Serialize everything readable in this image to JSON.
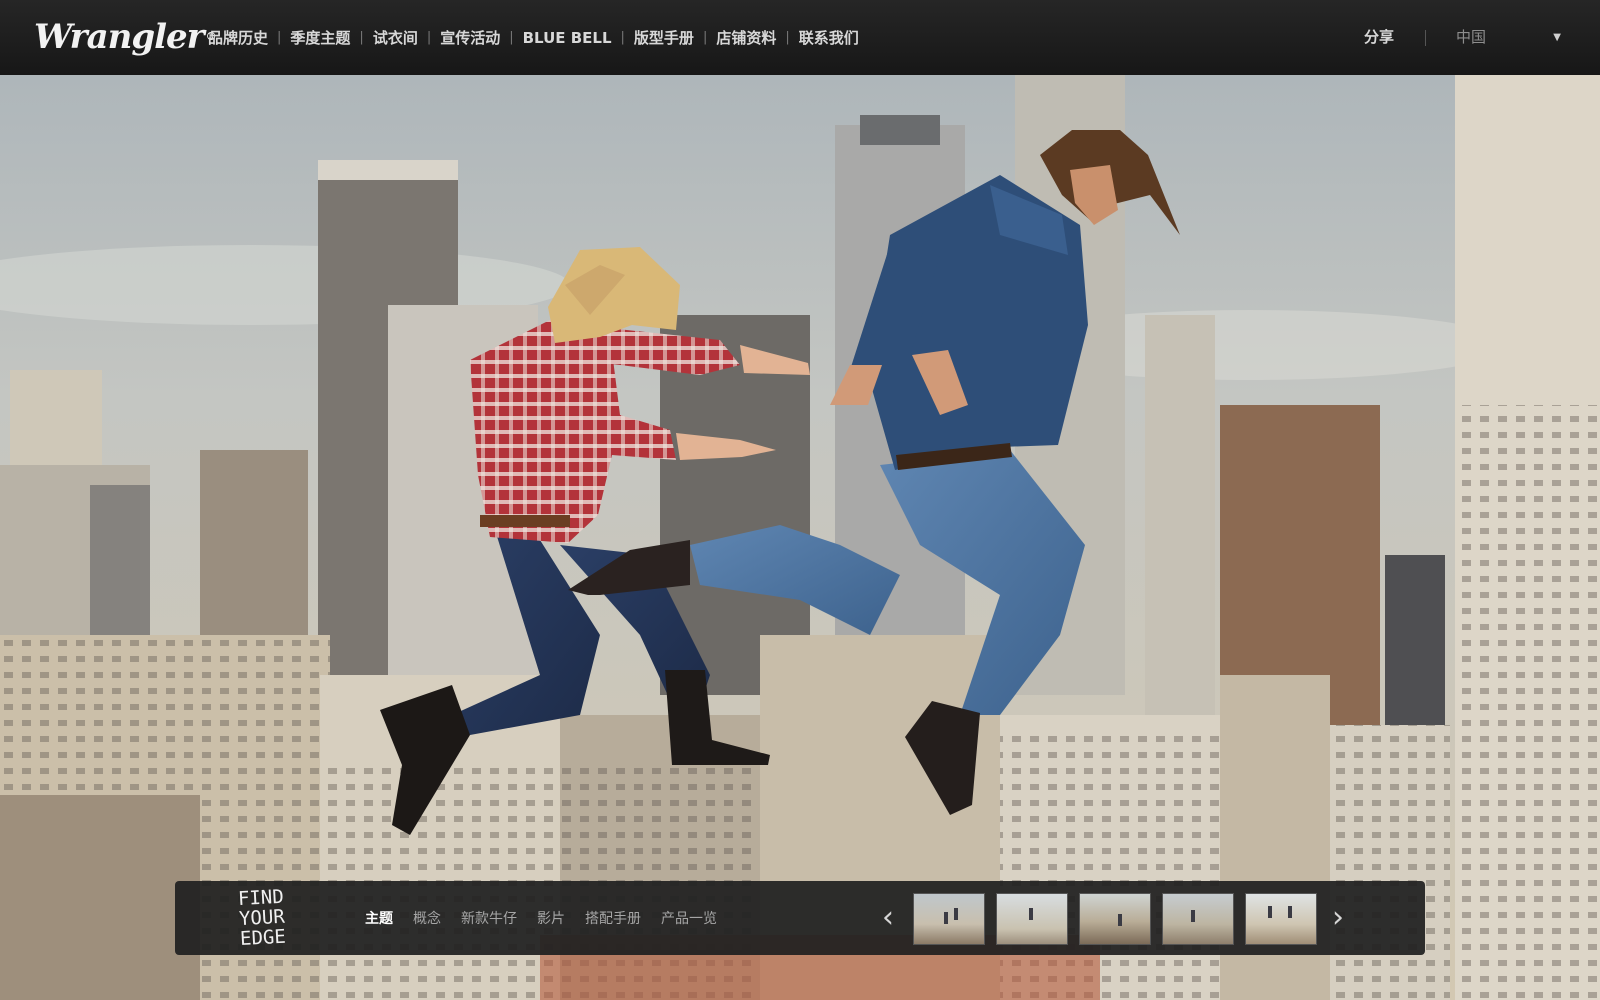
{
  "brand": {
    "logo_text": "Wrangler",
    "logo_mark": "®"
  },
  "main_nav": [
    {
      "label": "品牌历史"
    },
    {
      "label": "季度主题"
    },
    {
      "label": "试衣间"
    },
    {
      "label": "宣传活动"
    },
    {
      "label": "BLUE BELL"
    },
    {
      "label": "版型手册"
    },
    {
      "label": "店铺资料"
    },
    {
      "label": "联系我们"
    }
  ],
  "nav_separator": "|",
  "header_right": {
    "share_label": "分享",
    "region_label": "中国",
    "region_caret": "▼"
  },
  "bottom_bar": {
    "slogan": [
      "FIND",
      "YOUR",
      "EDGE"
    ],
    "subnav": [
      {
        "label": "主题",
        "active": true
      },
      {
        "label": "概念",
        "active": false
      },
      {
        "label": "新款牛仔",
        "active": false
      },
      {
        "label": "影片",
        "active": false
      },
      {
        "label": "搭配手册",
        "active": false
      },
      {
        "label": "产品一览",
        "active": false
      }
    ],
    "prev_arrow": "‹",
    "next_arrow": "›",
    "thumbnail_count": 5
  },
  "colors": {
    "topbar_bg": "#1c1c1c",
    "nav_text": "#d8d8d8",
    "active_text": "#ffffff",
    "inactive_text": "#a6a6a6"
  }
}
